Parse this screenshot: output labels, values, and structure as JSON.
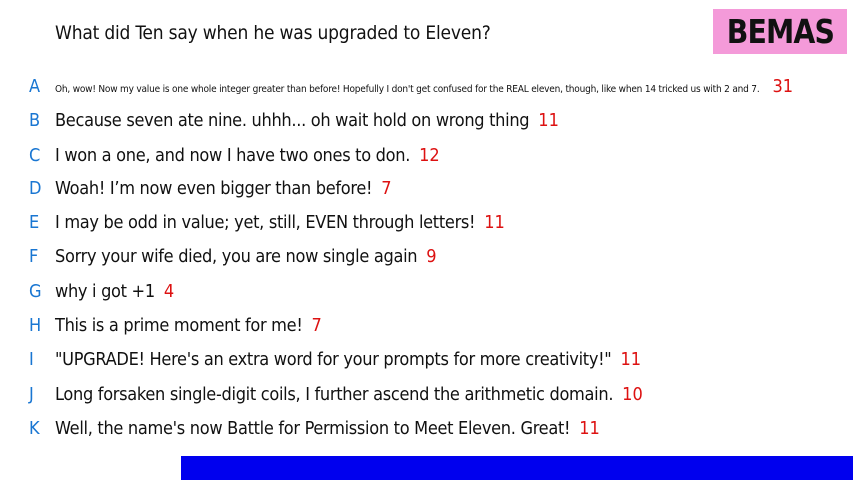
{
  "question": "What did Ten say when he was upgraded to Eleven?",
  "logo": "BEMAS",
  "answers": [
    {
      "letter": "A",
      "text": "Oh, wow! Now my value is one whole integer greater than before! Hopefully I don't get confused for the REAL eleven, though, like when 14 tricked us with 2 and 7.",
      "score": "31"
    },
    {
      "letter": "B",
      "text": "Because seven ate nine. uhhh... oh wait hold on wrong thing",
      "score": "11"
    },
    {
      "letter": "C",
      "text": "I won a one, and now I have two ones to don.",
      "score": "12"
    },
    {
      "letter": "D",
      "text": "Woah! I’m now even bigger than before!",
      "score": "7"
    },
    {
      "letter": "E",
      "text": "I may be odd in value; yet, still, EVEN through letters!",
      "score": "11"
    },
    {
      "letter": "F",
      "text": "Sorry your wife died, you are now single again",
      "score": "9"
    },
    {
      "letter": "G",
      "text": "why i got +1",
      "score": "4"
    },
    {
      "letter": "H",
      "text": "This is a prime moment for me!",
      "score": "7"
    },
    {
      "letter": "I",
      "text": "\"UPGRADE! Here's an extra word for your prompts for more creativity!\"",
      "score": "11"
    },
    {
      "letter": "J",
      "text": "Long forsaken single-digit coils, I further ascend the arithmetic domain.",
      "score": "10"
    },
    {
      "letter": "K",
      "text": "Well, the name's now Battle for Permission to Meet Eleven. Great!",
      "score": "11"
    }
  ],
  "colors": {
    "letter": "#1976d2",
    "score": "#dd1111",
    "logo_background": "#f49ad9",
    "bottom_bar": "#0000ee"
  }
}
